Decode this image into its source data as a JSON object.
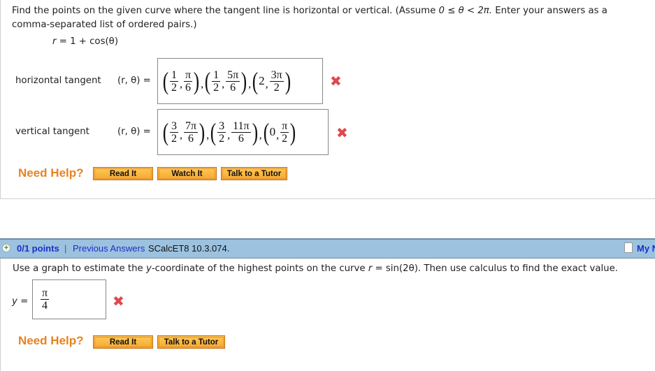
{
  "question1": {
    "prompt_part1": "Find the points on the given curve where the tangent line is horizontal or vertical. (Assume ",
    "prompt_math": "0 ≤ θ < 2π.",
    "prompt_part2": " Enter your answers as a comma-separated list of ordered pairs.)",
    "equation": {
      "lhs": "r",
      "rhs": " = 1 + cos(θ)"
    },
    "horizontal": {
      "label": "horizontal tangent",
      "var_label": "(r, θ) =",
      "answer": [
        {
          "r": {
            "num": "1",
            "den": "2"
          },
          "theta": {
            "num": "π",
            "den": "6"
          }
        },
        {
          "r": {
            "num": "1",
            "den": "2"
          },
          "theta": {
            "num": "5π",
            "den": "6"
          }
        },
        {
          "r": "2",
          "theta": {
            "num": "3π",
            "den": "2"
          }
        }
      ],
      "status": "incorrect",
      "status_icon": "✖"
    },
    "vertical": {
      "label": "vertical tangent",
      "var_label": "(r, θ) =",
      "answer": [
        {
          "r": {
            "num": "3",
            "den": "2"
          },
          "theta": {
            "num": "7π",
            "den": "6"
          }
        },
        {
          "r": {
            "num": "3",
            "den": "2"
          },
          "theta": {
            "num": "11π",
            "den": "6"
          }
        },
        {
          "r": "0",
          "theta": {
            "num": "π",
            "den": "2"
          }
        }
      ],
      "status": "incorrect",
      "status_icon": "✖"
    },
    "help": {
      "label": "Need Help?",
      "buttons": [
        "Read It",
        "Watch It",
        "Talk to a Tutor"
      ]
    }
  },
  "question2": {
    "header": {
      "points": "0/1 points",
      "separator": "|",
      "previous_answers": "Previous Answers",
      "code": "SCalcET8 10.3.074.",
      "my_notes": "My N"
    },
    "prompt_part1": "Use a graph to estimate the ",
    "prompt_var": "y",
    "prompt_part2": "-coordinate of the highest points on the curve ",
    "prompt_eq_lhs": "r",
    "prompt_eq_rhs": " = sin(2θ).",
    "prompt_part3": "  Then use calculus to find the exact value.",
    "answer_label": "y =",
    "answer": {
      "num": "π",
      "den": "4"
    },
    "status": "incorrect",
    "status_icon": "✖",
    "help": {
      "label": "Need Help?",
      "buttons": [
        "Read It",
        "Talk to a Tutor"
      ]
    }
  },
  "colors": {
    "help_orange": "#e8821e",
    "incorrect_red": "#e0474c",
    "header_blue": "#9cc2df",
    "link_blue": "#1a30c8"
  }
}
